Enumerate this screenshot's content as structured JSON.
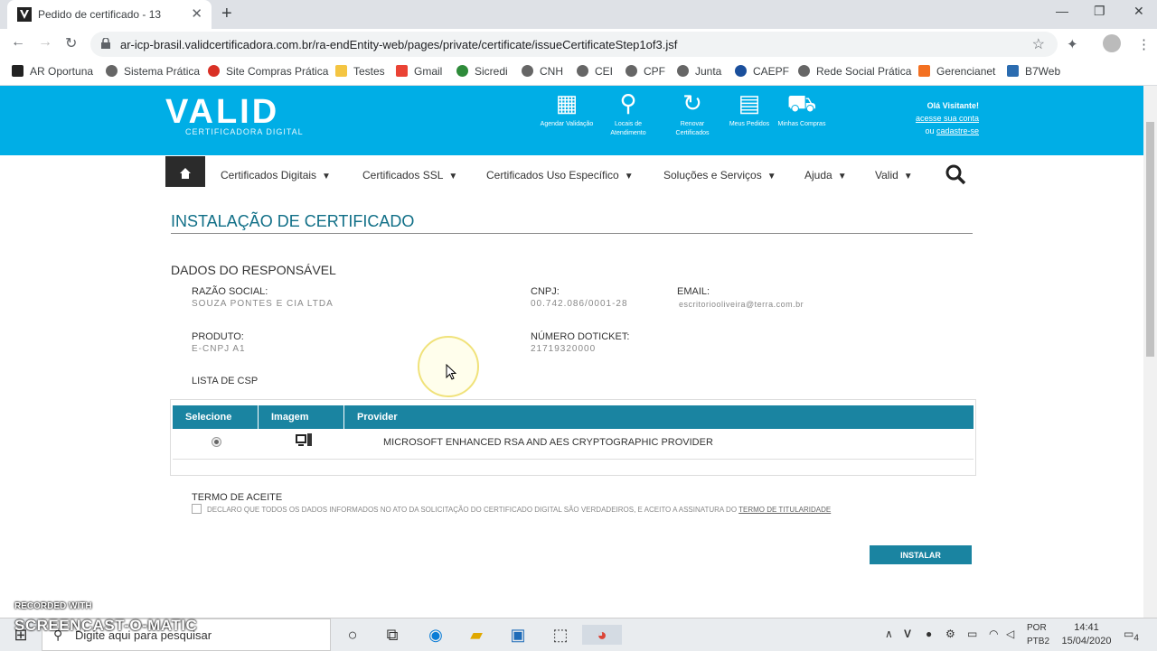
{
  "browser": {
    "tab_title": "Pedido de certificado - 13",
    "url": "ar-icp-brasil.validcertificadora.com.br/ra-endEntity-web/pages/private/certificate/issueCertificateStep1of3.jsf",
    "bookmarks": [
      "AR Oportuna",
      "Sistema Prática",
      "Site Compras Prática",
      "Testes",
      "Gmail",
      "Sicredi",
      "CNH",
      "CEI",
      "CPF",
      "Junta",
      "CAEPF",
      "Rede Social Prática",
      "Gerencianet",
      "B7Web"
    ]
  },
  "header": {
    "logo": "VALID",
    "logo_sub": "CERTIFICADORA DIGITAL",
    "icons": [
      {
        "label": "Agendar Validação"
      },
      {
        "label": "Locais de Atendimento"
      },
      {
        "label": "Renovar Certificados"
      },
      {
        "label": "Meus Pedidos"
      },
      {
        "label": "Minhas Compras"
      }
    ],
    "welcome": "Olá Visitante!",
    "access_link": "acesse sua conta",
    "or_text": "ou",
    "register_link": "cadastre-se"
  },
  "nav": {
    "items": [
      "Certificados Digitais",
      "Certificados SSL",
      "Certificados Uso Específico",
      "Soluções e Serviços",
      "Ajuda",
      "Valid"
    ]
  },
  "page": {
    "title": "INSTALAÇÃO DE  CERTIFICADO",
    "section": "DADOS DO RESPONSÁVEL",
    "fields": {
      "razao_label": "RAZÃO SOCIAL:",
      "razao_value": "SOUZA PONTES E CIA LTDA",
      "cnpj_label": "CNPJ:",
      "cnpj_value": "00.742.086/0001-28",
      "email_label": "EMAIL:",
      "email_value": "escritoriooliveira@terra.com.br",
      "produto_label": "PRODUTO:",
      "produto_value": "E-CNPJ A1",
      "ticket_label": "NÚMERO DOTICKET:",
      "ticket_value": "21719320000"
    },
    "csp_label": "LISTA DE CSP",
    "csp_table": {
      "headers": [
        "Selecione",
        "Imagem",
        "Provider"
      ],
      "rows": [
        {
          "provider": "MICROSOFT ENHANCED RSA AND AES CRYPTOGRAPHIC PROVIDER"
        }
      ]
    },
    "terms_label": "TERMO DE ACEITE",
    "terms_text": "DECLARO QUE TODOS OS DADOS INFORMADOS NO ATO DA SOLICITAÇÃO DO CERTIFICADO DIGITAL SÃO VERDADEIROS, E ACEITO A ASSINATURA DO",
    "terms_link": "TERMO DE TITULARIDADE",
    "install_button": "INSTALAR"
  },
  "watermark": {
    "line1": "RECORDED WITH",
    "line2": "SCREENCAST-O-MATIC"
  },
  "taskbar": {
    "search_placeholder": "Digite aqui para pesquisar",
    "lang1": "POR",
    "lang2": "PTB2",
    "time": "14:41",
    "date": "15/04/2020",
    "notifications": "4"
  }
}
